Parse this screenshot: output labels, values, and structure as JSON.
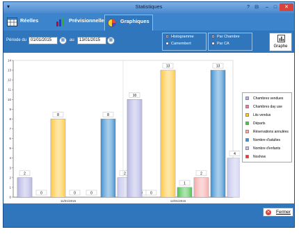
{
  "window": {
    "title": "Statistiques",
    "controls": {
      "help": "?",
      "minimize": "–",
      "maximize": "□",
      "close": "✕"
    }
  },
  "tabs": [
    {
      "label": "Réelles",
      "icon": "table-icon"
    },
    {
      "label": "Prévisionnelles",
      "icon": "bar-chart-icon"
    },
    {
      "label": "Graphiques",
      "icon": "pie-chart-icon",
      "active": true
    }
  ],
  "filters": {
    "periode_label": "Période du",
    "date_from": "01/01/2015",
    "au_label": "au",
    "date_to": "13/01/2015",
    "chart_type_options": [
      {
        "label": "Histogramme",
        "selected": true
      },
      {
        "label": "Camembert",
        "selected": false
      }
    ],
    "grouping_options": [
      {
        "label": "Par Chambre",
        "selected": true
      },
      {
        "label": "Par CA",
        "selected": false
      }
    ],
    "graphe_button": "Graphe"
  },
  "footer": {
    "fermer_label": "Fermer",
    "fermer_icon": "close-icon"
  },
  "chart_data": {
    "type": "bar",
    "ylim": [
      0,
      14
    ],
    "yticks": [
      "0",
      "1",
      "2",
      "3",
      "4",
      "5",
      "6",
      "7",
      "8",
      "9",
      "10",
      "11",
      "12",
      "13",
      "14"
    ],
    "categories": [
      "11/01/2015",
      "12/01/2015"
    ],
    "series": [
      {
        "name": "Chambres vendues",
        "color": "#b4b4e4",
        "values": [
          2,
          10
        ]
      },
      {
        "name": "Chambres day use",
        "color": "#e27ea0",
        "values": [
          0,
          0
        ]
      },
      {
        "name": "Lits vendus",
        "color": "#ffc840",
        "values": [
          8,
          13
        ]
      },
      {
        "name": "Départs",
        "color": "#4cc14c",
        "values": [
          0,
          1
        ]
      },
      {
        "name": "Réservations annulées",
        "color": "#f5a9a9",
        "values": [
          0,
          2
        ]
      },
      {
        "name": "Nombre d'adultes",
        "color": "#3d8fd1",
        "values": [
          8,
          13
        ]
      },
      {
        "name": "Nombre d'enfants",
        "color": "#c4c4ee",
        "values": [
          2,
          4
        ]
      },
      {
        "name": "Noshow",
        "color": "#e23a3a",
        "values": [
          0,
          0
        ]
      }
    ]
  }
}
